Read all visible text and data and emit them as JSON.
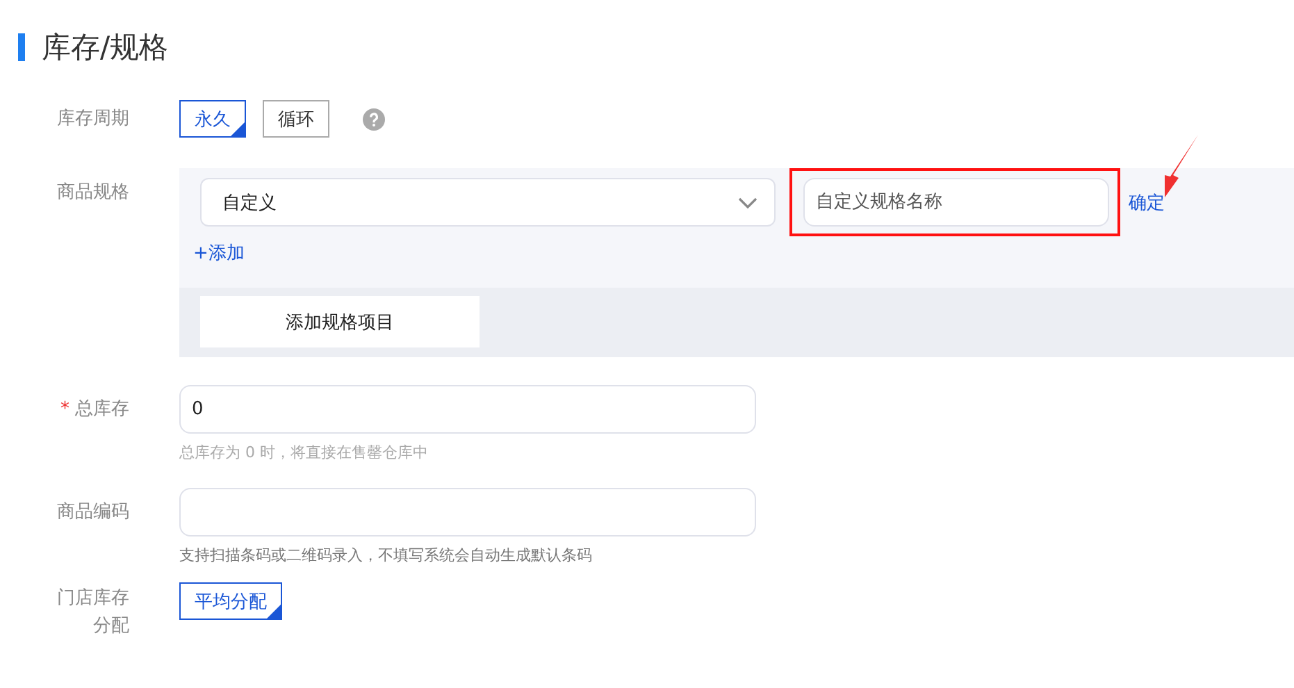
{
  "title": "库存/规格",
  "stock_period": {
    "label": "库存周期",
    "options": [
      {
        "label": "永久",
        "selected": true
      },
      {
        "label": "循环",
        "selected": false
      }
    ]
  },
  "spec": {
    "label": "商品规格",
    "select_value": "自定义",
    "name_field": {
      "placeholder": "自定义规格名称"
    },
    "confirm": "确定",
    "add_link": "+添加",
    "add_item_button": "添加规格项目"
  },
  "total_stock": {
    "label": "总库存",
    "required_mark": "*",
    "value": "0",
    "hint": "总库存为 0 时，将直接在售罄仓库中"
  },
  "code": {
    "label": "商品编码",
    "hint": "支持扫描条码或二维码录入，不填写系统会自动生成默认条码"
  },
  "store_alloc": {
    "label": "门店库存分配",
    "options": [
      {
        "label": "平均分配",
        "selected": true
      }
    ]
  }
}
